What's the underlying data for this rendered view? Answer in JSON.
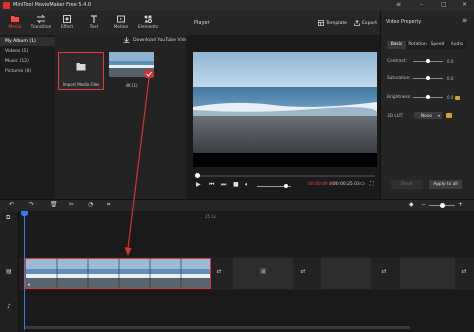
{
  "app": {
    "title": "MiniTool MovieMaker Free 5.4.0"
  },
  "toolbar": {
    "items": [
      {
        "label": "Media",
        "icon": "folder-icon",
        "active": true
      },
      {
        "label": "Transition",
        "icon": "transition-icon",
        "active": false
      },
      {
        "label": "Effect",
        "icon": "effect-icon",
        "active": false
      },
      {
        "label": "Text",
        "icon": "text-icon",
        "active": false
      },
      {
        "label": "Motion",
        "icon": "motion-icon",
        "active": false
      },
      {
        "label": "Elements",
        "icon": "elements-icon",
        "active": false
      }
    ]
  },
  "media": {
    "albums": [
      {
        "label": "My Album (1)",
        "active": true
      },
      {
        "label": "Videos (1)",
        "active": false
      },
      {
        "label": "Music (12)",
        "active": false
      },
      {
        "label": "Pictures (6)",
        "active": false
      }
    ],
    "download_label": "Download YouTube Videos",
    "import_label": "Import Media Files",
    "clip_name": "4K (1)"
  },
  "player": {
    "title": "Player",
    "template_label": "Template",
    "export_label": "Export",
    "time_current": "00:00:00.00",
    "time_separator": "/",
    "time_total": "00:00:25.03",
    "volume_level": 0.85
  },
  "properties": {
    "title": "Video Property",
    "tabs": [
      {
        "label": "Basic",
        "active": true
      },
      {
        "label": "Rotation",
        "active": false
      },
      {
        "label": "Speed",
        "active": false
      },
      {
        "label": "Audio",
        "active": false
      }
    ],
    "sliders": [
      {
        "label": "Contrast:",
        "value": "0.0",
        "level": 0.5
      },
      {
        "label": "Saturation:",
        "value": "0.0",
        "level": 0.5
      },
      {
        "label": "Brightness:",
        "value": "0.0",
        "level": 0.5
      }
    ],
    "lut_label": "3D LUT:",
    "lut_value": "None",
    "reset_label": "Reset",
    "apply_all_label": "Apply to all"
  },
  "timeline": {
    "ruler_mark": "25.1s",
    "accent": "#2f7fe6",
    "selection_color": "#d23a3a"
  }
}
